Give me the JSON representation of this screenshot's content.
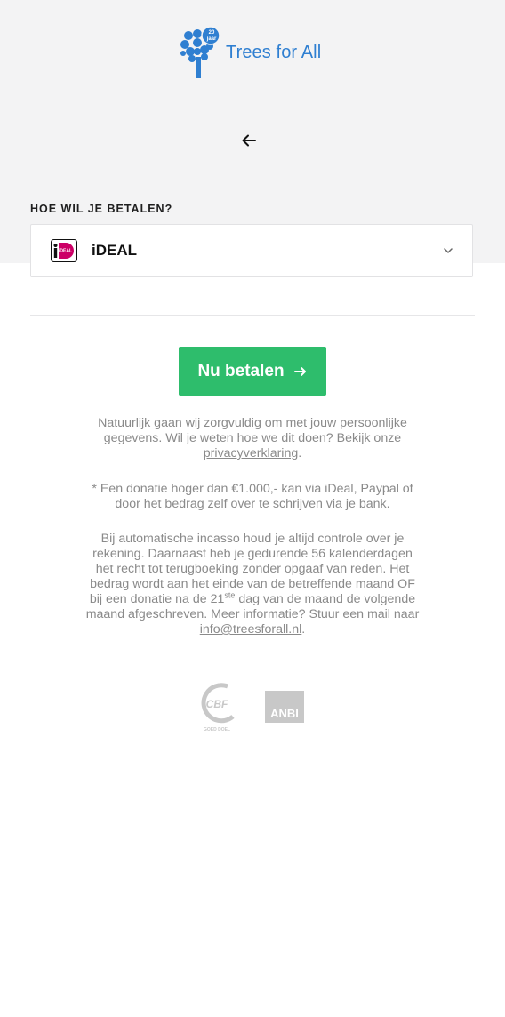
{
  "brand": {
    "name": "Trees for All",
    "badge": "20 jaar",
    "color": "#2f7fd1"
  },
  "payment": {
    "section_label": "HOE WIL JE BETALEN?",
    "selected_method": "iDEAL",
    "logo_text": "iDEAL"
  },
  "button": {
    "label": "Nu betalen"
  },
  "info": {
    "privacy_text": "Natuurlijk gaan wij zorgvuldig om met jouw persoonlijke gegevens. Wil je weten hoe we dit doen? Bekijk onze ",
    "privacy_link": "privacyverklaring",
    "privacy_end": ".",
    "donation_note": "* Een donatie hoger dan €1.000,- kan via iDeal, Paypal of door het bedrag zelf over te schrijven via je bank.",
    "incasso_text": "Bij automatische incasso houd je altijd controle over je rekening. Daarnaast heb je gedurende 56 kalenderdagen het recht tot terugboeking zonder opgaaf van reden. Het bedrag wordt aan het einde van de betreffende maand OF bij een donatie na de 21",
    "incasso_sup": "ste",
    "incasso_text2": " dag van de maand de volgende maand afgeschreven. Meer informatie? Stuur een mail naar ",
    "email_link": "info@treesforall.nl",
    "incasso_end": "."
  },
  "badges": {
    "cbf": "CBF",
    "cbf_sub": "GOED DOEL",
    "anbi": "ANBI"
  },
  "colors": {
    "accent": "#2ebd6c",
    "background": "#f3f3f4",
    "ideal": "#cc0066"
  }
}
